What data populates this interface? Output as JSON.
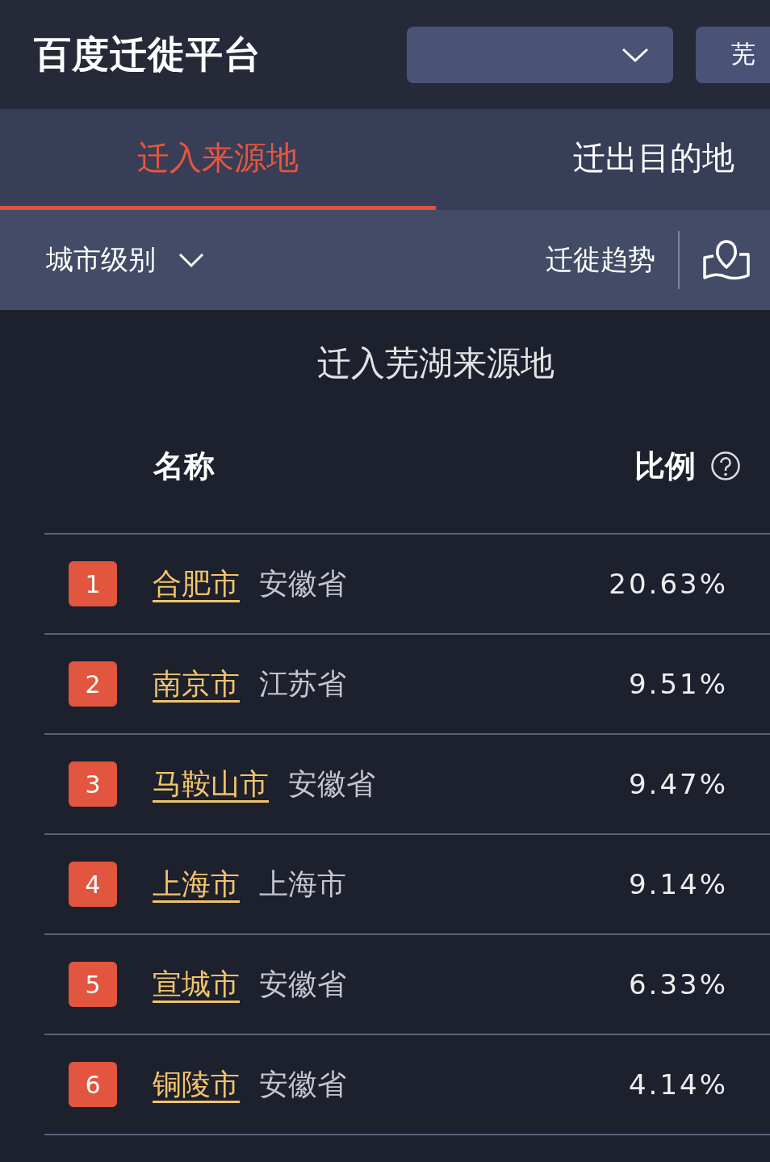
{
  "header": {
    "logo": "百度迁徙平台",
    "city_button": "芜"
  },
  "tabs": [
    {
      "label": "迁入来源地",
      "selected": true
    },
    {
      "label": "迁出目的地",
      "selected": false
    }
  ],
  "toolbar": {
    "filter": "城市级别",
    "trend_button": "迁徙趋势"
  },
  "panel": {
    "title": "迁入芜湖来源地",
    "columns": [
      "名称",
      "比例"
    ],
    "rows": [
      {
        "rank": "1",
        "city": "合肥市",
        "province": "安徽省",
        "share": "20.63%"
      },
      {
        "rank": "2",
        "city": "南京市",
        "province": "江苏省",
        "share": "9.51%"
      },
      {
        "rank": "3",
        "city": "马鞍山市",
        "province": "安徽省",
        "share": "9.47%"
      },
      {
        "rank": "4",
        "city": "上海市",
        "province": "上海市",
        "share": "9.14%"
      },
      {
        "rank": "5",
        "city": "宣城市",
        "province": "安徽省",
        "share": "6.33%"
      },
      {
        "rank": "6",
        "city": "铜陵市",
        "province": "安徽省",
        "share": "4.14%"
      }
    ]
  }
}
